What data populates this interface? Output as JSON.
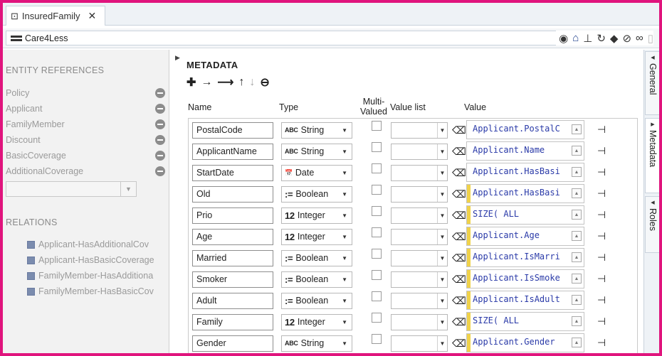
{
  "tab": {
    "icon": "model-icon",
    "title": "InsuredFamily",
    "close": "✕"
  },
  "breadcrumb": {
    "label": "Care4Less"
  },
  "entity_references": {
    "heading": "ENTITY REFERENCES",
    "items": [
      {
        "label": "Policy"
      },
      {
        "label": "Applicant"
      },
      {
        "label": "FamilyMember"
      },
      {
        "label": "Discount"
      },
      {
        "label": "BasicCoverage"
      },
      {
        "label": "AdditionalCoverage"
      }
    ]
  },
  "relations": {
    "heading": "RELATIONS",
    "items": [
      {
        "label": "Applicant-HasAdditionalCov"
      },
      {
        "label": "Applicant-HasBasicCoverage"
      },
      {
        "label": "FamilyMember-HasAdditiona"
      },
      {
        "label": "FamilyMember-HasBasicCov"
      }
    ]
  },
  "metadata": {
    "title": "METADATA",
    "columns": {
      "name": "Name",
      "type": "Type",
      "multi": "Multi-Valued",
      "multi_l1": "Multi-",
      "multi_l2": "Valued",
      "valuelist": "Value list",
      "value": "Value"
    },
    "rows": [
      {
        "name": "PostalCode",
        "type_icon": "ABC",
        "type": "String",
        "value": "Applicant.PostalC",
        "yellow": false
      },
      {
        "name": "ApplicantName",
        "type_icon": "ABC",
        "type": "String",
        "value": "Applicant.Name",
        "yellow": false
      },
      {
        "name": "StartDate",
        "type_icon": "📅",
        "type": "Date",
        "value": "Applicant.HasBasi",
        "yellow": false
      },
      {
        "name": "Old",
        "type_icon": ":=",
        "type": "Boolean",
        "value": "Applicant.HasBasi",
        "yellow": true
      },
      {
        "name": "Prio",
        "type_icon": "12",
        "type": "Integer",
        "value": "SIZE( ALL",
        "yellow": true
      },
      {
        "name": "Age",
        "type_icon": "12",
        "type": "Integer",
        "value": "Applicant.Age",
        "yellow": true
      },
      {
        "name": "Married",
        "type_icon": ":=",
        "type": "Boolean",
        "value": "Applicant.IsMarri",
        "yellow": true
      },
      {
        "name": "Smoker",
        "type_icon": ":=",
        "type": "Boolean",
        "value": "Applicant.IsSmoke",
        "yellow": true
      },
      {
        "name": "Adult",
        "type_icon": ":=",
        "type": "Boolean",
        "value": "Applicant.IsAdult",
        "yellow": true
      },
      {
        "name": "Family",
        "type_icon": "12",
        "type": "Integer",
        "value": "SIZE( ALL",
        "yellow": true
      },
      {
        "name": "Gender",
        "type_icon": "ABC",
        "type": "String",
        "value": "Applicant.Gender",
        "yellow": true
      }
    ]
  },
  "side_tabs": [
    {
      "label": "General"
    },
    {
      "label": "Metadata"
    },
    {
      "label": "Roles"
    }
  ],
  "colors": {
    "accent_border": "#e0147d",
    "expr_bar": "#f0d24a",
    "code": "#2a3aa8"
  }
}
